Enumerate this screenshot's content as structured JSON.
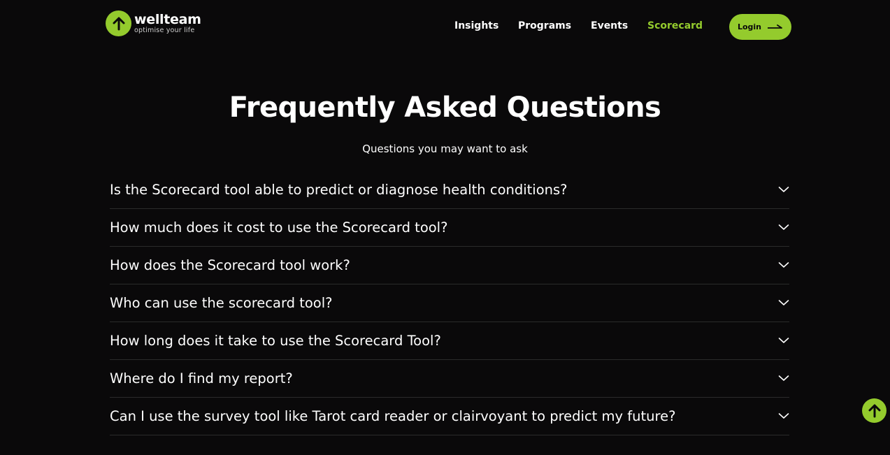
{
  "header": {
    "logo": {
      "name": "wellteam",
      "tagline": "optimise your life",
      "icon": "up-arrow-icon"
    },
    "nav": [
      {
        "label": "Insights",
        "active": false
      },
      {
        "label": "Programs",
        "active": false
      },
      {
        "label": "Events",
        "active": false
      },
      {
        "label": "Scorecard",
        "active": true
      }
    ],
    "login": {
      "label": "Login",
      "icon": "arrow-right-icon"
    }
  },
  "hero": {
    "title": "Frequently Asked Questions",
    "subtitle": "Questions you may want to ask"
  },
  "faq": [
    {
      "question": "Is the Scorecard tool able to predict or diagnose health conditions?"
    },
    {
      "question": "How much does it cost to use the Scorecard tool?"
    },
    {
      "question": "How does the Scorecard tool work?"
    },
    {
      "question": "Who can use the scorecard tool?"
    },
    {
      "question": "How long does it take to use the Scorecard Tool?"
    },
    {
      "question": "Where do I find my report?"
    },
    {
      "question": "Can I use the survey tool like Tarot card reader or clairvoyant to predict my future?"
    }
  ],
  "scroll_top": {
    "icon": "arrow-up-icon"
  },
  "colors": {
    "background": "#0a090a",
    "accent": "#94cb2d",
    "text": "#ffffff",
    "divider": "#2b2b2b"
  }
}
